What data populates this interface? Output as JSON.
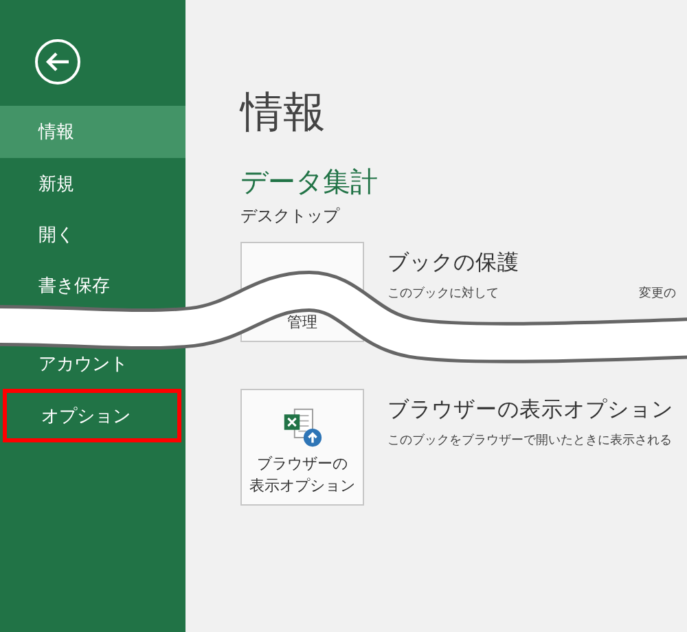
{
  "sidebar": {
    "items": [
      {
        "label": "情報",
        "selected": true,
        "highlighted": false
      },
      {
        "label": "新規",
        "selected": false,
        "highlighted": false
      },
      {
        "label": "開く",
        "selected": false,
        "highlighted": false
      },
      {
        "label": "書き保存",
        "selected": false,
        "highlighted": false
      },
      {
        "label": "アカウント",
        "selected": false,
        "highlighted": false
      },
      {
        "label": "オプション",
        "selected": false,
        "highlighted": true
      }
    ]
  },
  "main": {
    "title": "情報",
    "file_name": "データ集計",
    "location": "デスクトップ",
    "sections": [
      {
        "kind": "protect",
        "button_label": [
          "管理"
        ],
        "heading": "ブックの保護",
        "description": [
          "このブックに対して",
          "変更の"
        ]
      },
      {
        "kind": "browser",
        "button_label": [
          "ブラウザーの",
          "表示オプション"
        ],
        "heading": "ブラウザーの表示オプション",
        "description": [
          "このブックをブラウザーで開いたときに表示される"
        ]
      }
    ]
  }
}
